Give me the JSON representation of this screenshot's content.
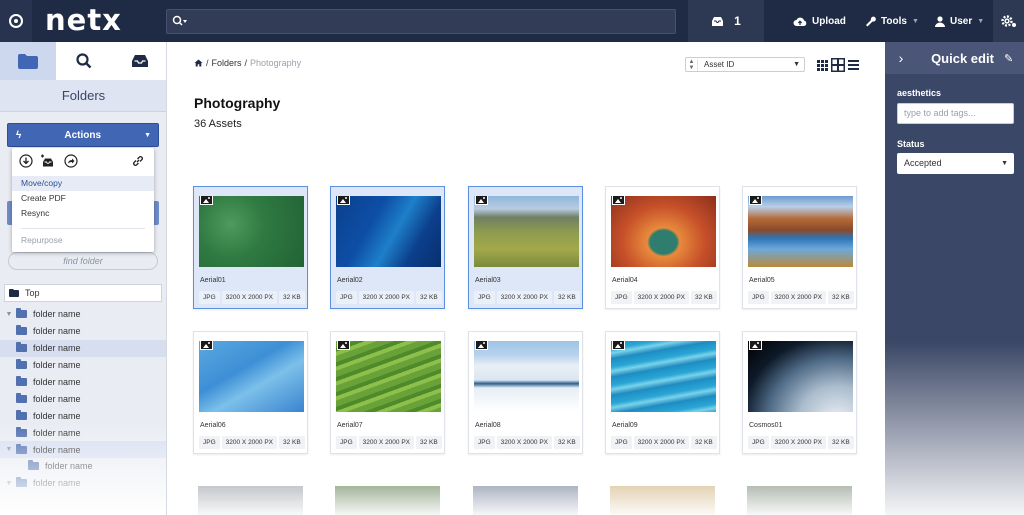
{
  "topbar": {
    "logo": "netx",
    "cart_count": "1",
    "upload_label": "Upload",
    "tools_label": "Tools",
    "user_label": "User"
  },
  "left": {
    "folders_title": "Folders",
    "actions_label": "Actions",
    "dropdown_items": [
      "Move/copy",
      "Create PDF",
      "Resync",
      "Repurpose"
    ],
    "find_folder_placeholder": "find folder",
    "top_label": "Top",
    "tree": [
      "folder name",
      "folder name",
      "folder name",
      "folder name",
      "folder name",
      "folder name",
      "folder name",
      "folder name",
      "folder name",
      "folder name",
      "folder name"
    ]
  },
  "main": {
    "breadcrumb": {
      "sep1": "/",
      "folders": "Folders",
      "sep2": "/",
      "current": "Photography"
    },
    "sort_value": "Asset ID",
    "title": "Photography",
    "asset_count": "36 Assets",
    "assets": [
      {
        "name": "Aerial01",
        "type": "JPG",
        "dims": "3200 X 2000 PX",
        "size": "32 KB",
        "selected": true
      },
      {
        "name": "Aerial02",
        "type": "JPG",
        "dims": "3200 X 2000 PX",
        "size": "32 KB",
        "selected": true
      },
      {
        "name": "Aerial03",
        "type": "JPG",
        "dims": "3200 X 2000 PX",
        "size": "32 KB",
        "selected": true
      },
      {
        "name": "Aerial04",
        "type": "JPG",
        "dims": "3200 X 2000 PX",
        "size": "32 KB",
        "selected": false
      },
      {
        "name": "Aerial05",
        "type": "JPG",
        "dims": "3200 X 2000 PX",
        "size": "32 KB",
        "selected": false
      },
      {
        "name": "Aerial06",
        "type": "JPG",
        "dims": "3200 X 2000 PX",
        "size": "32 KB",
        "selected": false
      },
      {
        "name": "Aerial07",
        "type": "JPG",
        "dims": "3200 X 2000 PX",
        "size": "32 KB",
        "selected": false
      },
      {
        "name": "Aerial08",
        "type": "JPG",
        "dims": "3200 X 2000 PX",
        "size": "32 KB",
        "selected": false
      },
      {
        "name": "Aerial09",
        "type": "JPG",
        "dims": "3200 X 2000 PX",
        "size": "32 KB",
        "selected": false
      },
      {
        "name": "Cosmos01",
        "type": "JPG",
        "dims": "3200 X 2000 PX",
        "size": "32 KB",
        "selected": false
      }
    ]
  },
  "right": {
    "title": "Quick edit",
    "tags_label": "aesthetics",
    "tags_placeholder": "type to add tags...",
    "status_label": "Status",
    "status_value": "Accepted"
  },
  "colors": {
    "topbar": "#1f2a44",
    "accent": "#4066b4",
    "right_panel": "#3b4766",
    "selected_card": "#dde7f7"
  }
}
